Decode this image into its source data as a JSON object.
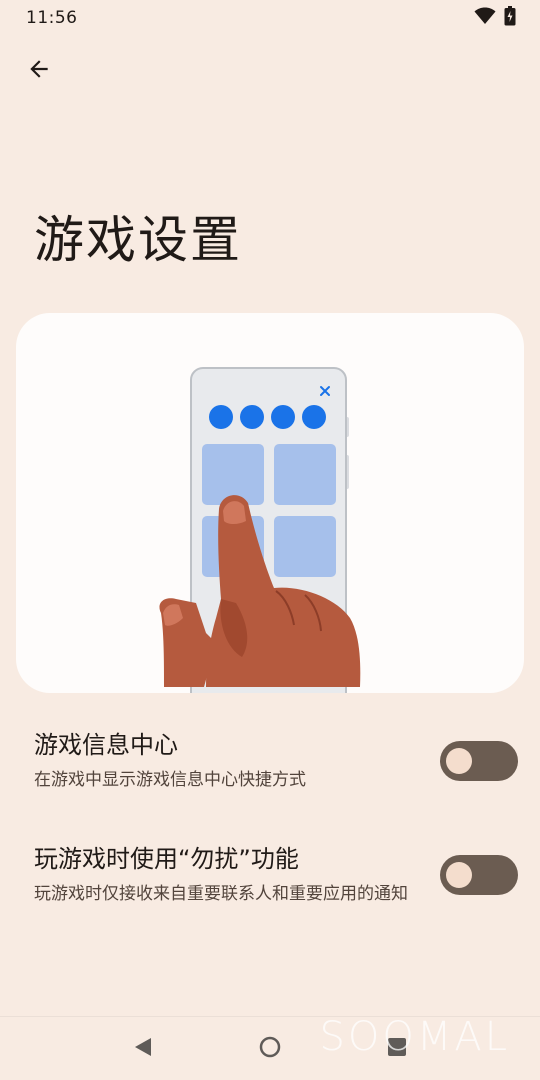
{
  "status_bar": {
    "time": "11:56",
    "icons": [
      "wifi-icon",
      "battery-icon"
    ]
  },
  "header": {
    "back_icon": "arrow-left-icon",
    "title": "游戏设置"
  },
  "illustration": {
    "description_icon": "phone-hand-illustration"
  },
  "settings": [
    {
      "title": "游戏信息中心",
      "summary": "在游戏中显示游戏信息中心快捷方式",
      "checked": false
    },
    {
      "title": "玩游戏时使用“勿扰”功能",
      "summary": "玩游戏时仅接收来自重要联系人和重要应用的通知",
      "checked": false
    }
  ],
  "nav_bar": {
    "icons": [
      "back-triangle-icon",
      "home-circle-icon",
      "recents-square-icon"
    ]
  },
  "watermark": "SOOMAL",
  "colors": {
    "background": "#f8ebe2",
    "card": "#fefcfb",
    "toggle_track": "#6b5c51",
    "toggle_thumb": "#f4ddcd",
    "accent_blue": "#1a73e8"
  }
}
